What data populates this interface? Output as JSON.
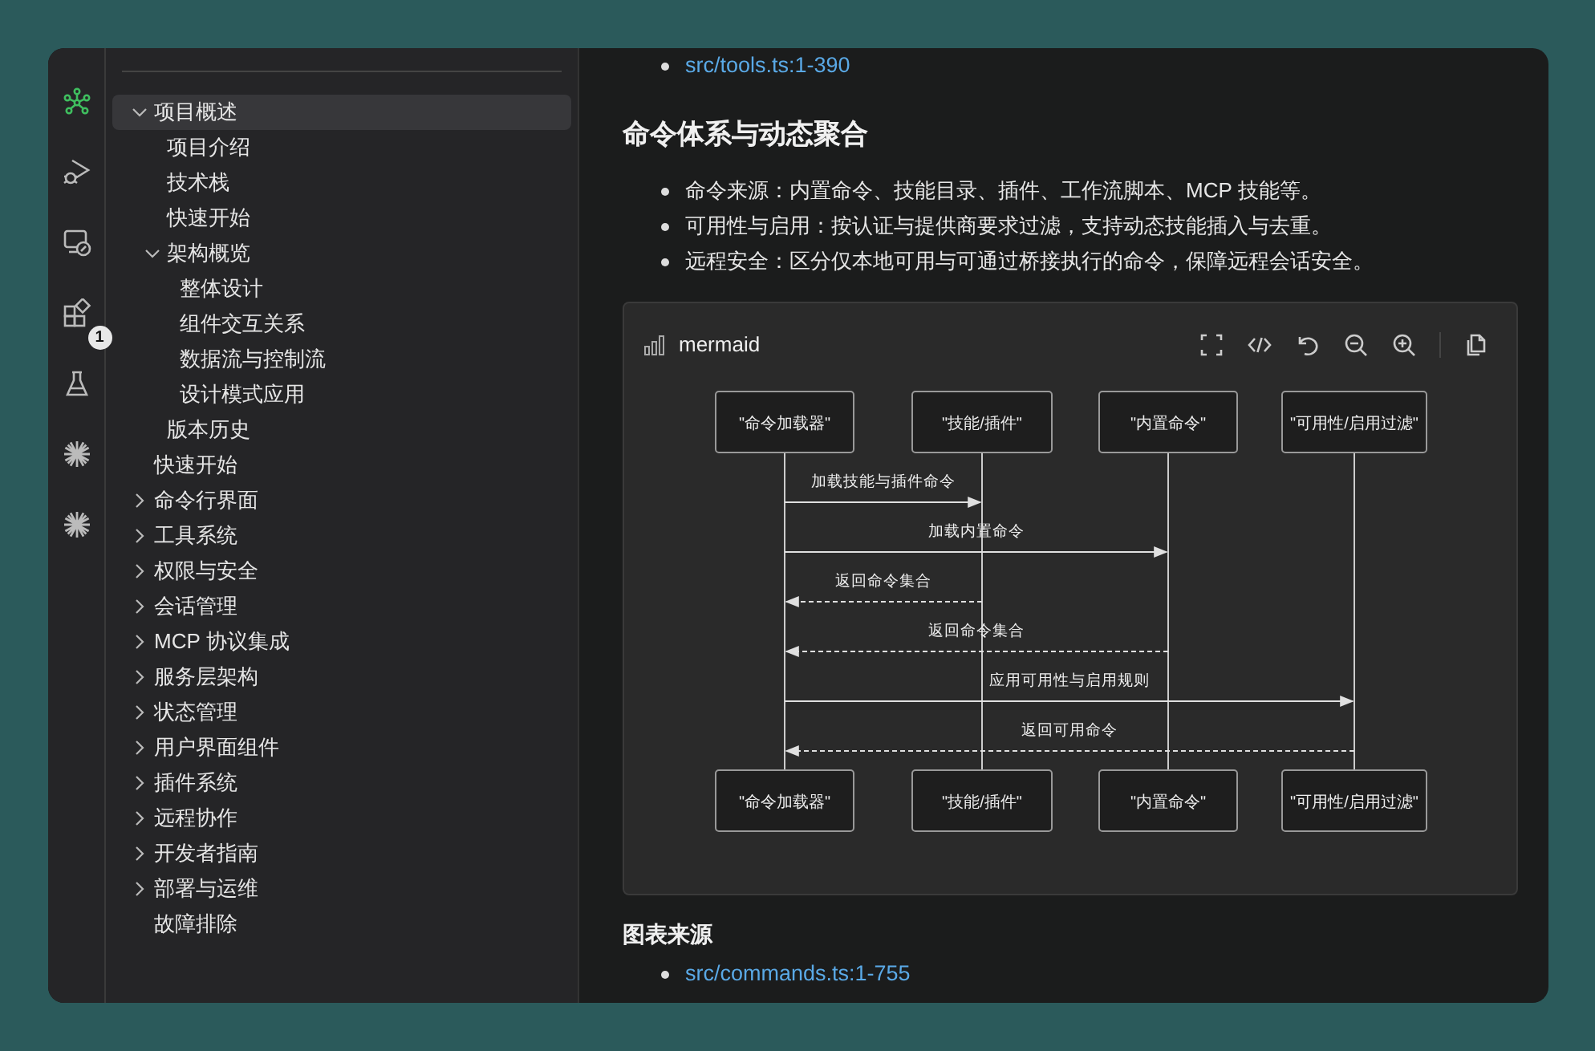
{
  "activity_bar": [
    {
      "kind": "graph",
      "selected": true
    },
    {
      "kind": "debug",
      "selected": false
    },
    {
      "kind": "remote",
      "selected": false
    },
    {
      "kind": "extensions",
      "selected": false,
      "badge": "1"
    },
    {
      "kind": "flask",
      "selected": false
    },
    {
      "kind": "sparkle",
      "selected": false
    },
    {
      "kind": "sparkle",
      "selected": false
    }
  ],
  "sidebar": {
    "items": [
      {
        "label": "项目概述",
        "expanded": true,
        "selected": true,
        "children": [
          {
            "label": "项目介绍",
            "selected": false
          },
          {
            "label": "技术栈",
            "selected": false
          },
          {
            "label": "快速开始",
            "selected": false
          },
          {
            "label": "架构概览",
            "expanded": true,
            "selected": false,
            "children": [
              {
                "label": "整体设计",
                "selected": false
              },
              {
                "label": "组件交互关系",
                "selected": false
              },
              {
                "label": "数据流与控制流",
                "selected": false
              },
              {
                "label": "设计模式应用",
                "selected": false
              }
            ]
          },
          {
            "label": "版本历史",
            "selected": false
          }
        ]
      },
      {
        "label": "快速开始",
        "selected": false
      },
      {
        "label": "命令行界面",
        "expanded": false,
        "selected": false
      },
      {
        "label": "工具系统",
        "expanded": false,
        "selected": false
      },
      {
        "label": "权限与安全",
        "expanded": false,
        "selected": false
      },
      {
        "label": "会话管理",
        "expanded": false,
        "selected": false
      },
      {
        "label": "MCP 协议集成",
        "expanded": false,
        "selected": false
      },
      {
        "label": "服务层架构",
        "expanded": false,
        "selected": false
      },
      {
        "label": "状态管理",
        "expanded": false,
        "selected": false
      },
      {
        "label": "用户界面组件",
        "expanded": false,
        "selected": false
      },
      {
        "label": "插件系统",
        "expanded": false,
        "selected": false
      },
      {
        "label": "远程协作",
        "expanded": false,
        "selected": false
      },
      {
        "label": "开发者指南",
        "expanded": false,
        "selected": false
      },
      {
        "label": "部署与运维",
        "expanded": false,
        "selected": false
      },
      {
        "label": "故障排除",
        "selected": false
      }
    ]
  },
  "content": {
    "top_links": [
      "src/tools.ts:1-390"
    ],
    "heading": "命令体系与动态聚合",
    "bullets": [
      "命令来源：内置命令、技能目录、插件、工作流脚本、MCP 技能等。",
      "可用性与启用：按认证与提供商要求过滤，支持动态技能插入与去重。",
      "远程安全：区分仅本地可用与可通过桥接执行的命令，保障远程会话安全。"
    ],
    "diagram": {
      "label": "mermaid",
      "top_actors": [
        "\"命令加载器\"",
        "\"技能/插件\"",
        "\"内置命令\"",
        "\"可用性/启用过滤\""
      ],
      "bottom_actors": [
        "\"命令加载器\"",
        "\"技能/插件\"",
        "\"内置命令\"",
        "\"可用性/启用过滤\""
      ],
      "messages": [
        {
          "label": "加载技能与插件命令",
          "kind": "call"
        },
        {
          "label": "加载内置命令",
          "kind": "call"
        },
        {
          "label": "返回命令集合",
          "kind": "return"
        },
        {
          "label": "返回命令集合",
          "kind": "return"
        },
        {
          "label": "应用可用性与启用规则",
          "kind": "call"
        },
        {
          "label": "返回可用命令",
          "kind": "return"
        }
      ]
    },
    "sources_heading": "图表来源",
    "source_links": [
      "src/commands.ts:1-755"
    ]
  }
}
